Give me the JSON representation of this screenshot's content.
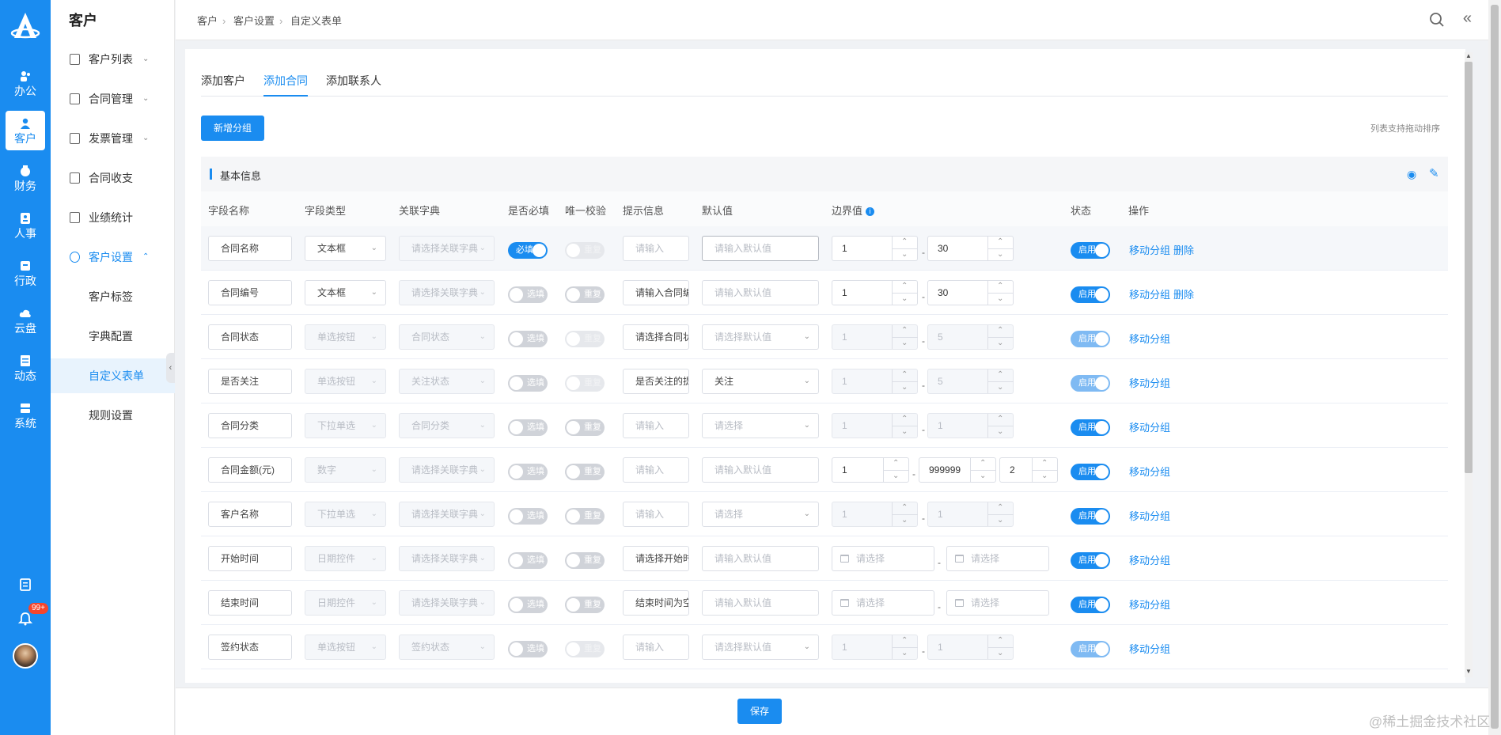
{
  "rail": {
    "items": [
      {
        "label": "办公",
        "icon": "people-icon"
      },
      {
        "label": "客户",
        "icon": "customer-icon"
      },
      {
        "label": "财务",
        "icon": "finance-icon"
      },
      {
        "label": "人事",
        "icon": "hr-icon"
      },
      {
        "label": "行政",
        "icon": "admin-icon"
      },
      {
        "label": "云盘",
        "icon": "cloud-icon"
      },
      {
        "label": "动态",
        "icon": "feed-icon"
      },
      {
        "label": "系统",
        "icon": "system-icon"
      }
    ],
    "notification_badge": "99+"
  },
  "sidebar": {
    "title": "客户",
    "items": [
      {
        "label": "客户列表"
      },
      {
        "label": "合同管理"
      },
      {
        "label": "发票管理"
      },
      {
        "label": "合同收支"
      },
      {
        "label": "业绩统计"
      },
      {
        "label": "客户设置"
      }
    ],
    "sub_items": [
      {
        "label": "客户标签"
      },
      {
        "label": "字典配置"
      },
      {
        "label": "自定义表单"
      },
      {
        "label": "规则设置"
      }
    ]
  },
  "breadcrumb": [
    "客户",
    "客户设置",
    "自定义表单"
  ],
  "tabs": [
    "添加客户",
    "添加合同",
    "添加联系人"
  ],
  "add_group_button": "新增分组",
  "sort_hint": "列表支持拖动排序",
  "group_title": "基本信息",
  "columns": [
    "字段名称",
    "字段类型",
    "关联字典",
    "是否必填",
    "唯一校验",
    "提示信息",
    "默认值",
    "边界值",
    "状态",
    "操作"
  ],
  "rows": [
    {
      "name": "合同名称",
      "type": "文本框",
      "dict": "请选择关联字典",
      "required": "必填",
      "unique": "重复",
      "tip": "请输入",
      "default": "请输入默认值",
      "min": "1",
      "max": "30",
      "status": "启用",
      "move": "移动分组",
      "delete": "删除"
    },
    {
      "name": "合同编号",
      "type": "文本框",
      "dict": "请选择关联字典",
      "required": "选填",
      "unique": "重复",
      "tip": "请输入合同编",
      "default": "请输入默认值",
      "min": "1",
      "max": "30",
      "status": "启用",
      "move": "移动分组",
      "delete": "删除"
    },
    {
      "name": "合同状态",
      "type": "单选按钮",
      "dict": "合同状态",
      "required": "选填",
      "unique": "重复",
      "tip": "请选择合同状",
      "default": "请选择默认值",
      "min": "1",
      "max": "5",
      "status": "启用",
      "move": "移动分组"
    },
    {
      "name": "是否关注",
      "type": "单选按钮",
      "dict": "关注状态",
      "required": "选填",
      "unique": "重复",
      "tip": "是否关注的提",
      "default": "关注",
      "min": "1",
      "max": "5",
      "status": "启用",
      "move": "移动分组"
    },
    {
      "name": "合同分类",
      "type": "下拉单选",
      "dict": "合同分类",
      "required": "选填",
      "unique": "重复",
      "tip": "请输入",
      "default": "请选择",
      "min": "1",
      "max": "1",
      "status": "启用",
      "move": "移动分组"
    },
    {
      "name": "合同金额(元)",
      "type": "数字",
      "dict": "请选择关联字典",
      "required": "选填",
      "unique": "重复",
      "tip": "请输入",
      "default": "请输入默认值",
      "min": "1",
      "max": "999999",
      "precision": "2",
      "status": "启用",
      "move": "移动分组"
    },
    {
      "name": "客户名称",
      "type": "下拉单选",
      "dict": "请选择关联字典",
      "required": "选填",
      "unique": "重复",
      "tip": "请输入",
      "default": "请选择",
      "min": "1",
      "max": "1",
      "status": "启用",
      "move": "移动分组"
    },
    {
      "name": "开始时间",
      "type": "日期控件",
      "dict": "请选择关联字典",
      "required": "选填",
      "unique": "重复",
      "tip": "请选择开始时",
      "default": "请输入默认值",
      "date_min": "请选择",
      "date_max": "请选择",
      "status": "启用",
      "move": "移动分组"
    },
    {
      "name": "结束时间",
      "type": "日期控件",
      "dict": "请选择关联字典",
      "required": "选填",
      "unique": "重复",
      "tip": "结束时间为空",
      "default": "请输入默认值",
      "date_min": "请选择",
      "date_max": "请选择",
      "status": "启用",
      "move": "移动分组"
    },
    {
      "name": "签约状态",
      "type": "单选按钮",
      "dict": "签约状态",
      "required": "选填",
      "unique": "重复",
      "tip": "请输入",
      "default": "请选择默认值",
      "min": "1",
      "max": "1",
      "status": "启用",
      "move": "移动分组"
    }
  ],
  "save_button": "保存",
  "watermark": "@稀土掘金技术社区"
}
